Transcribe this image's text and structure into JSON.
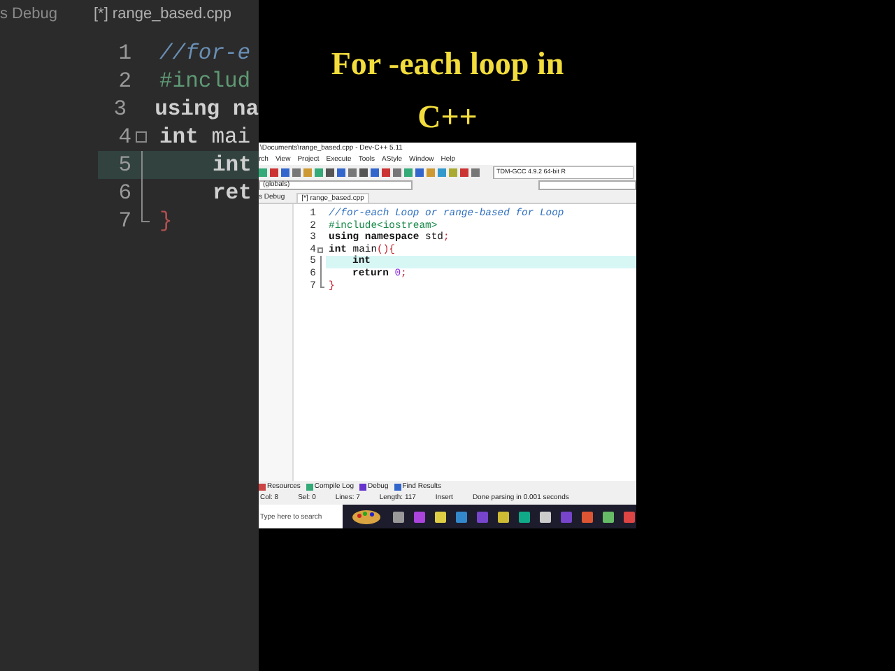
{
  "video_title": [
    "For -each loop in C++"
  ],
  "background_zoom": {
    "tabs": [
      {
        "label": "s Debug",
        "selected": false
      },
      {
        "label": "[*] range_based.cpp",
        "selected": true
      }
    ],
    "lines": [
      {
        "number": "1",
        "current": false,
        "indent": false,
        "fold_start": false,
        "in_fold": false,
        "fold_end": false,
        "tokens": [
          {
            "kind": "comment",
            "text": "//for-e"
          }
        ]
      },
      {
        "number": "2",
        "current": false,
        "indent": false,
        "fold_start": false,
        "in_fold": false,
        "fold_end": false,
        "tokens": [
          {
            "kind": "preprocessor",
            "text": "#includ"
          }
        ]
      },
      {
        "number": "3",
        "current": false,
        "indent": false,
        "fold_start": false,
        "in_fold": false,
        "fold_end": false,
        "tokens": [
          {
            "kind": "keyword",
            "text": "using na"
          }
        ]
      },
      {
        "number": "4",
        "current": false,
        "indent": false,
        "fold_start": true,
        "in_fold": false,
        "fold_end": false,
        "tokens": [
          {
            "kind": "keyword",
            "text": "int"
          },
          {
            "kind": "plain",
            "text": " mai"
          }
        ]
      },
      {
        "number": "5",
        "current": true,
        "indent": true,
        "fold_start": false,
        "in_fold": true,
        "fold_end": false,
        "tokens": [
          {
            "kind": "keyword",
            "text": "int"
          }
        ]
      },
      {
        "number": "6",
        "current": false,
        "indent": true,
        "fold_start": false,
        "in_fold": true,
        "fold_end": false,
        "tokens": [
          {
            "kind": "keyword",
            "text": "ret"
          }
        ]
      },
      {
        "number": "7",
        "current": false,
        "indent": false,
        "fold_start": false,
        "in_fold": true,
        "fold_end": true,
        "tokens": [
          {
            "kind": "symbol",
            "text": "}"
          }
        ]
      }
    ]
  },
  "ide": {
    "window_title": "\\Documents\\range_based.cpp - Dev-C++ 5.11",
    "menu": [
      "rch",
      "View",
      "Project",
      "Execute",
      "Tools",
      "AStyle",
      "Window",
      "Help"
    ],
    "compiler": "TDM-GCC 4.9.2 64-bit R",
    "scope": "(globals)",
    "side_tab": "s Debug",
    "tabs": [
      {
        "label": "[*] range_based.cpp",
        "selected": true
      }
    ],
    "lines": [
      {
        "number": "1",
        "current": false,
        "indent": false,
        "fold_start": false,
        "in_fold": false,
        "fold_end": false,
        "tokens": [
          {
            "kind": "comment",
            "text": "//for-each Loop or range-based for Loop"
          }
        ]
      },
      {
        "number": "2",
        "current": false,
        "indent": false,
        "fold_start": false,
        "in_fold": false,
        "fold_end": false,
        "tokens": [
          {
            "kind": "preprocessor",
            "text": "#include<iostream>"
          }
        ]
      },
      {
        "number": "3",
        "current": false,
        "indent": false,
        "fold_start": false,
        "in_fold": false,
        "fold_end": false,
        "tokens": [
          {
            "kind": "keyword",
            "text": "using namespace"
          },
          {
            "kind": "plain",
            "text": " std"
          },
          {
            "kind": "symbol",
            "text": ";"
          }
        ]
      },
      {
        "number": "4",
        "current": false,
        "indent": false,
        "fold_start": true,
        "in_fold": false,
        "fold_end": false,
        "tokens": [
          {
            "kind": "keyword",
            "text": "int"
          },
          {
            "kind": "plain",
            "text": " main"
          },
          {
            "kind": "symbol",
            "text": "(){"
          }
        ]
      },
      {
        "number": "5",
        "current": true,
        "indent": true,
        "fold_start": false,
        "in_fold": true,
        "fold_end": false,
        "tokens": [
          {
            "kind": "keyword",
            "text": "int"
          }
        ]
      },
      {
        "number": "6",
        "current": false,
        "indent": true,
        "fold_start": false,
        "in_fold": true,
        "fold_end": false,
        "tokens": [
          {
            "kind": "keyword",
            "text": "return"
          },
          {
            "kind": "number",
            "text": " 0"
          },
          {
            "kind": "symbol",
            "text": ";"
          }
        ]
      },
      {
        "number": "7",
        "current": false,
        "indent": false,
        "fold_start": false,
        "in_fold": true,
        "fold_end": true,
        "tokens": [
          {
            "kind": "symbol",
            "text": "}"
          }
        ]
      }
    ],
    "bottom_tabs": [
      {
        "label": "Resources",
        "kind": "resources"
      },
      {
        "label": "Compile Log",
        "kind": "log"
      },
      {
        "label": "Debug",
        "kind": "debug"
      },
      {
        "label": "Find Results",
        "kind": "find"
      }
    ],
    "status": [
      {
        "label": "Col:",
        "value": "8"
      },
      {
        "label": "Sel:",
        "value": "0"
      },
      {
        "label": "Lines:",
        "value": "7"
      },
      {
        "label": "Length:",
        "value": "117"
      },
      {
        "value": "Insert"
      },
      {
        "value": "Done parsing in 0.001 seconds"
      }
    ],
    "taskbar": {
      "search_placeholder": "Type here to search"
    }
  }
}
